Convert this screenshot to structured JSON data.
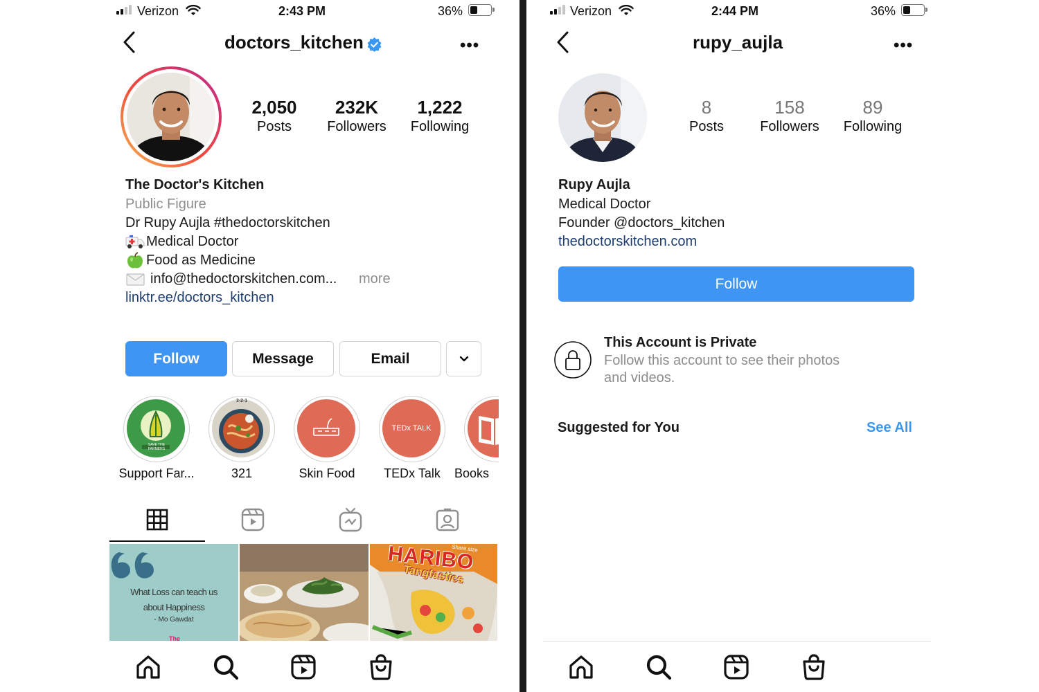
{
  "left": {
    "status": {
      "carrier": "Verizon",
      "time": "2:43 PM",
      "battery": "36%"
    },
    "header": {
      "username": "doctors_kitchen"
    },
    "stats": [
      {
        "value": "2,050",
        "label": "Posts"
      },
      {
        "value": "232K",
        "label": "Followers"
      },
      {
        "value": "1,222",
        "label": "Following"
      }
    ],
    "bio": {
      "name": "The Doctor's Kitchen",
      "category": "Public Figure",
      "line1": "Dr Rupy Aujla #thedoctorskitchen",
      "line2": "Medical Doctor",
      "line3": "Food as Medicine",
      "line4": "info@thedoctorskitchen.com...",
      "more": "more",
      "link": "linktr.ee/doctors_kitchen"
    },
    "buttons": {
      "follow": "Follow",
      "message": "Message",
      "email": "Email"
    },
    "highlights": [
      {
        "label": "Support Far...",
        "badge": "SAVE THE FARMERS"
      },
      {
        "label": "321",
        "badge": "3-2-1"
      },
      {
        "label": "Skin Food"
      },
      {
        "label": "TEDx Talk",
        "badge": "TEDx TALK"
      },
      {
        "label": "Books"
      }
    ],
    "posts": [
      {
        "quote_line1": "What Loss can teach us",
        "quote_line2": "about Happiness",
        "author": "- Mo Gawdat",
        "peek": "The"
      },
      {
        "kind": "photo-greens-and-flatbread"
      },
      {
        "brand": "HARIBO",
        "product": "Tangfastics",
        "tag": "Share size"
      }
    ]
  },
  "right": {
    "status": {
      "carrier": "Verizon",
      "time": "2:44 PM",
      "battery": "36%"
    },
    "header": {
      "username": "rupy_aujla"
    },
    "stats": [
      {
        "value": "8",
        "label": "Posts"
      },
      {
        "value": "158",
        "label": "Followers"
      },
      {
        "value": "89",
        "label": "Following"
      }
    ],
    "bio": {
      "name": "Rupy Aujla",
      "line1": "Medical Doctor",
      "line2": "Founder @doctors_kitchen",
      "link": "thedoctorskitchen.com"
    },
    "buttons": {
      "follow": "Follow"
    },
    "private": {
      "title": "This Account is Private",
      "desc1": "Follow this account to see their photos",
      "desc2": "and videos."
    },
    "suggested": {
      "title": "Suggested for You",
      "see_all": "See All"
    }
  },
  "colors": {
    "accent": "#3f95f4",
    "link": "#1e3d6f",
    "muted": "#8e8e8e",
    "verified": "#3897f0"
  },
  "battery_level": 0.36
}
